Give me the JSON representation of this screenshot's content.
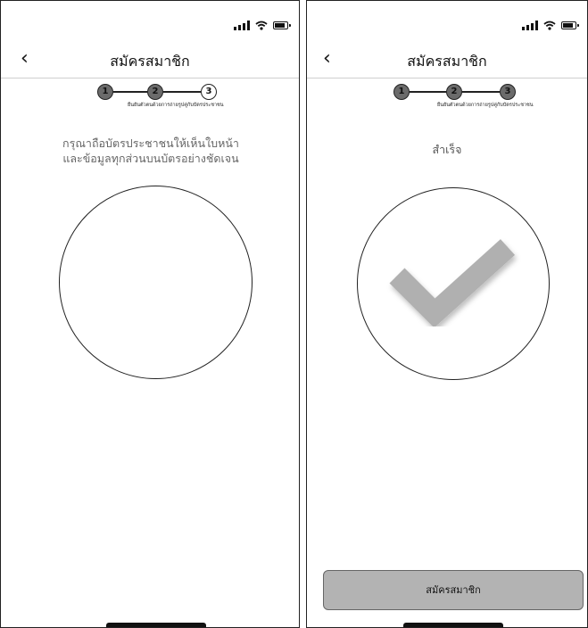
{
  "left_screen": {
    "header": {
      "title": "สมัครสมาชิก"
    },
    "stepper": {
      "steps": [
        "1",
        "2",
        "3"
      ],
      "label": "ยืนยันตัวตนด้วยการถ่ายรูปคู่กับบัตรประชาชน"
    },
    "instruction": {
      "line1": "กรุณาถือบัตรประชาชนให้เห็นใบหน้า",
      "line2": "และข้อมูลทุกส่วนบนบัตรอย่างชัดเจน"
    }
  },
  "right_screen": {
    "header": {
      "title": "สมัครสมาชิก"
    },
    "stepper": {
      "steps": [
        "1",
        "2",
        "3"
      ],
      "label": "ยืนยันตัวตนด้วยการถ่ายรูปคู่กับบัตรประชาชน"
    },
    "status_text": "สำเร็จ",
    "submit_label": "สมัครสมาชิก"
  },
  "colors": {
    "step_done": "#6b6b6b",
    "button_bg": "#b3b3b3",
    "check": "#b0b0b0"
  }
}
